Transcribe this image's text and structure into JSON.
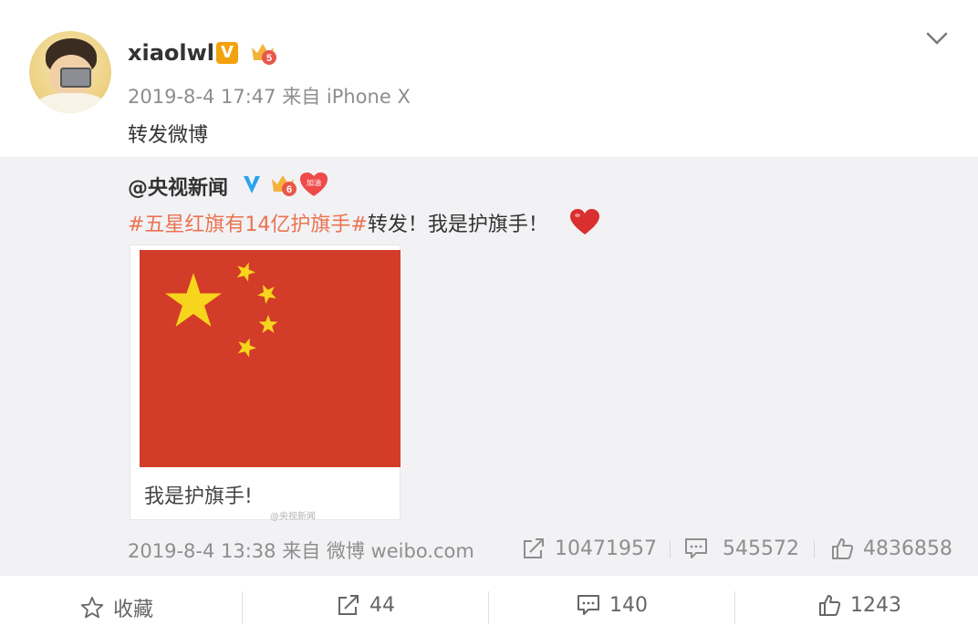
{
  "post": {
    "username": "xiaolwl",
    "v_badge": "V",
    "level_badge": "5",
    "timestamp": "2019-8-4 17:47",
    "source": "来自 iPhone X",
    "text": "转发微博"
  },
  "repost": {
    "username": "@央视新闻",
    "level_badge": "6",
    "heart_badge": "加油",
    "hashtag": "#五星红旗有14亿护旗手#",
    "text": "转发！我是护旗手！",
    "image_caption": "我是护旗手!",
    "watermark": "@央视新闻",
    "timestamp": "2019-8-4 13:38",
    "source": "来自 微博 weibo.com",
    "reposts": "10471957",
    "comments": "545572",
    "likes": "4836858"
  },
  "actions": {
    "favorite": "收藏",
    "repost_count": "44",
    "comment_count": "140",
    "like_count": "1243"
  },
  "colors": {
    "hashtag": "#eb7350",
    "flag_red": "#d33c28",
    "flag_star": "#f7d51d",
    "repost_bg": "#f2f2f5",
    "muted_text": "#8e8e8e"
  },
  "icons": [
    "chevron-down-icon",
    "repost-icon",
    "comment-icon",
    "like-icon",
    "star-icon",
    "verified-icon",
    "crown-icon",
    "heart-icon"
  ]
}
